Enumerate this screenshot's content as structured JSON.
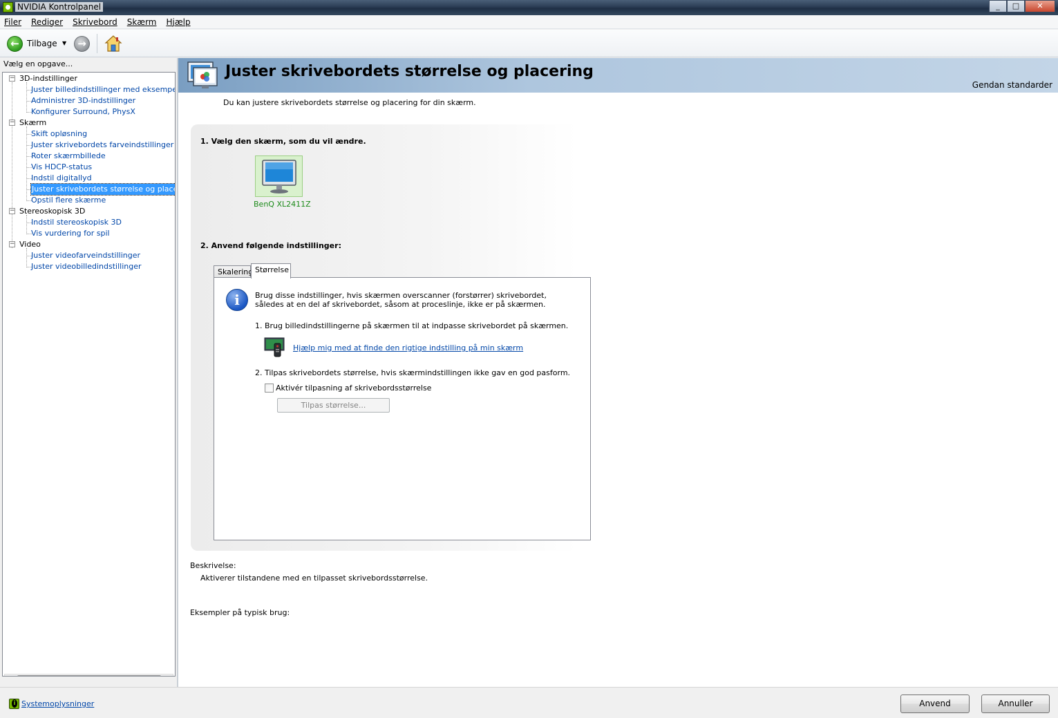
{
  "window": {
    "title": "NVIDIA Kontrolpanel",
    "controls": {
      "minimize": "_",
      "maximize": "□",
      "close": "✕"
    }
  },
  "menubar": {
    "items": [
      "Filer",
      "Rediger",
      "Skrivebord",
      "Skærm",
      "Hjælp"
    ]
  },
  "toolbar": {
    "back_label": "Tilbage",
    "back_icon": "←",
    "forward_icon": "→",
    "dropdown_icon": "▼"
  },
  "sidebar": {
    "task_label": "Vælg en opgave...",
    "categories": [
      {
        "label": "3D-indstillinger",
        "toggle": "−",
        "items": [
          "Juster billedindstillinger med eksempel",
          "Administrer 3D-indstillinger",
          "Konfigurer Surround, PhysX"
        ]
      },
      {
        "label": "Skærm",
        "toggle": "−",
        "items": [
          "Skift opløsning",
          "Juster skrivebordets farveindstillinger",
          "Roter skærmbillede",
          "Vis HDCP-status",
          "Indstil digitallyd",
          "Juster skrivebordets størrelse og placering",
          "Opstil flere skærme"
        ]
      },
      {
        "label": "Stereoskopisk 3D",
        "toggle": "−",
        "items": [
          "Indstil stereoskopisk 3D",
          "Vis vurdering for spil"
        ]
      },
      {
        "label": "Video",
        "toggle": "−",
        "items": [
          "Juster videofarveindstillinger",
          "Juster videobilledindstillinger"
        ]
      }
    ],
    "selected": "Juster skrivebordets størrelse og placering",
    "scroll": {
      "left": "◀",
      "right": "▶",
      "grip": "|||"
    }
  },
  "main": {
    "title": "Juster skrivebordets størrelse og placering",
    "restore_label": "Gendan standarder",
    "intro": "Du kan justere skrivebordets størrelse og placering for din skærm.",
    "step1_title": "1. Vælg den skærm, som du vil ændre.",
    "monitor_name": "BenQ XL2411Z",
    "step2_title": "2. Anvend følgende indstillinger:",
    "tabs": [
      "Skalering",
      "Størrelse"
    ],
    "active_tab": "Størrelse",
    "info_icon_glyph": "i",
    "info_text": "Brug disse indstillinger, hvis skærmen overscanner (forstørrer) skrivebordet, således at en del af skrivebordet, såsom at proceslinje, ikke er på skærmen.",
    "instruction1": "1. Brug billedindstillingerne på skærmen til at indpasse skrivebordet på skærmen.",
    "help_link": "Hjælp mig med at finde den rigtige indstilling på min skærm",
    "instruction2": "2. Tilpas skrivebordets størrelse, hvis skærmindstillingen ikke gav en god pasform.",
    "checkbox_label": "Aktivér tilpasning af skrivebordsstørrelse",
    "checkbox_checked": false,
    "resize_button": "Tilpas størrelse...",
    "description_label": "Beskrivelse:",
    "description_text": "Aktiverer tilstandene med en tilpasset skrivebordsstørrelse.",
    "examples_label": "Eksempler på typisk brug:"
  },
  "footer": {
    "sysinfo_link": "Systemoplysninger",
    "apply_button": "Anvend",
    "cancel_button": "Annuller"
  },
  "colors": {
    "link": "#0046a8",
    "selection": "#3399ff",
    "nvidia_green": "#76b900",
    "monitor_label": "#1c8a19"
  }
}
